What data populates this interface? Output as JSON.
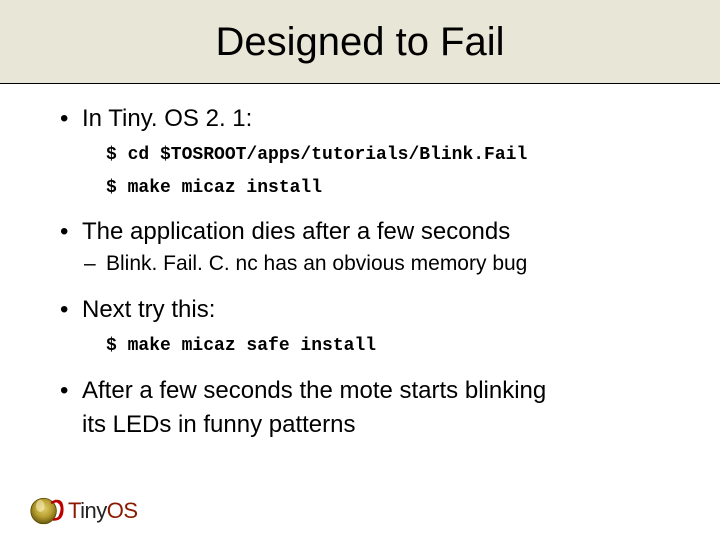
{
  "title": "Designed to Fail",
  "bullets": {
    "b1": "In Tiny. OS 2. 1:",
    "cmd1": "$ cd $TOSROOT/apps/tutorials/Blink.Fail",
    "cmd2": "$ make micaz install",
    "b2": "The application dies after a few seconds",
    "b2a": "Blink. Fail. C. nc has an obvious memory bug",
    "b3": "Next try this:",
    "cmd3": "$ make micaz safe install",
    "b4a": "After a few seconds the mote starts blinking",
    "b4b": "its LEDs in funny patterns"
  },
  "logo": {
    "text": "TinyOS"
  }
}
